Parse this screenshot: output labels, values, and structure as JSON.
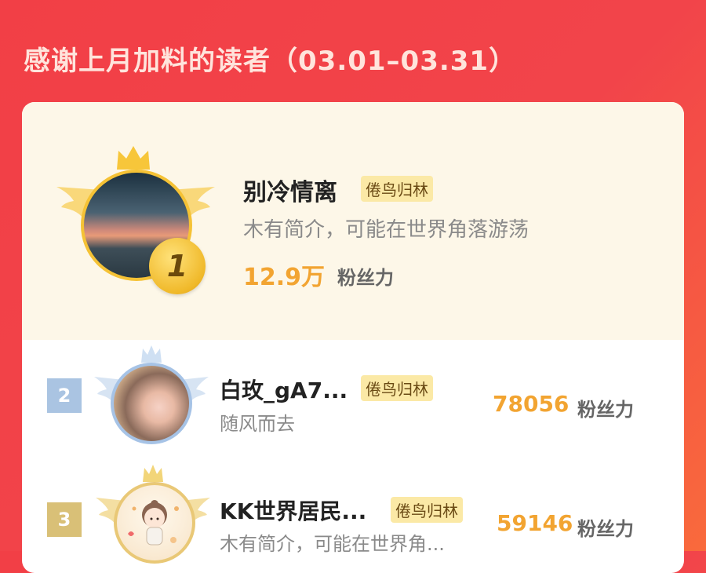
{
  "header": {
    "title": "感谢上月加料的读者（03.01–03.31）"
  },
  "readers": [
    {
      "rank": "1",
      "name": "别冷情离",
      "tag": "倦鸟归林",
      "bio": "木有简介，可能在世界角落游荡",
      "fans_value": "12.9万",
      "fans_unit": "粉丝力"
    },
    {
      "rank": "2",
      "name": "白玫_gA7...",
      "tag": "倦鸟归林",
      "bio": "随风而去",
      "fans_value": "78056",
      "fans_unit": "粉丝力"
    },
    {
      "rank": "3",
      "name": "KK世界居民...",
      "tag": "倦鸟归林",
      "bio": "木有简介，可能在世界角...",
      "fans_value": "59146",
      "fans_unit": "粉丝力"
    }
  ],
  "colors": {
    "background": "#f2444a",
    "gold": "#f5c235",
    "silver": "#a6c3e6",
    "fans_value": "#f2a431",
    "tag_bg": "#fbe9a6"
  },
  "icons": [
    "crown-icon",
    "wing-icon",
    "rank-badge-icon"
  ]
}
